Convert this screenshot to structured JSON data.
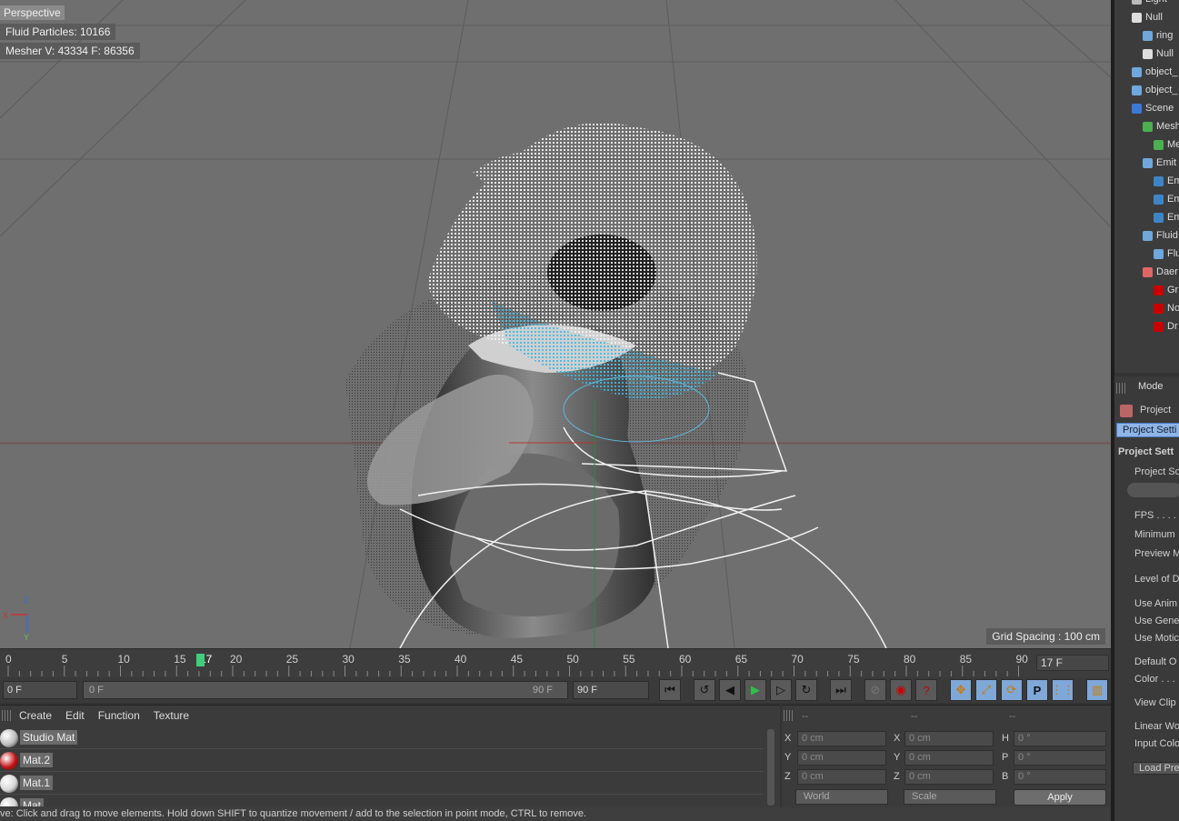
{
  "viewport": {
    "label": "Perspective",
    "hud_particles": "Fluid  Particles: 10166",
    "hud_mesher": "Mesher  V: 43334  F: 86356",
    "grid_spacing": "Grid Spacing : 100 cm"
  },
  "timeline": {
    "ticks": [
      "0",
      "5",
      "10",
      "15",
      "17",
      "20",
      "25",
      "30",
      "35",
      "40",
      "45",
      "50",
      "55",
      "60",
      "65",
      "70",
      "75",
      "80",
      "85",
      "90"
    ],
    "current_frame_box": "17 F",
    "start_field": "0 F",
    "range_start": "0 F",
    "range_end": "90 F",
    "end_field": "90 F"
  },
  "materials": {
    "menu": [
      "Create",
      "Edit",
      "Function",
      "Texture"
    ],
    "items": [
      {
        "name": "Studio Mat",
        "color": "#bdbdbd"
      },
      {
        "name": "Mat.2",
        "color": "#c41212"
      },
      {
        "name": "Mat.1",
        "color": "#d6d6d6"
      },
      {
        "name": "Mat",
        "color": "#cfcfcf"
      }
    ]
  },
  "coords": {
    "headers": [
      "--",
      "--",
      "--"
    ],
    "rows": [
      {
        "l1": "X",
        "v1": "0 cm",
        "l2": "X",
        "v2": "0 cm",
        "l3": "H",
        "v3": "0 °"
      },
      {
        "l1": "Y",
        "v1": "0 cm",
        "l2": "Y",
        "v2": "0 cm",
        "l3": "P",
        "v3": "0 °"
      },
      {
        "l1": "Z",
        "v1": "0 cm",
        "l2": "Z",
        "v2": "0 cm",
        "l3": "B",
        "v3": "0 °"
      }
    ],
    "space": "World",
    "mode": "Scale",
    "apply": "Apply"
  },
  "status": "ve: Click and drag to move elements. Hold down SHIFT to quantize movement / add to the selection in point mode, CTRL to remove.",
  "objects": [
    {
      "label": "Light",
      "indent": 18,
      "color": "#bbbbbb"
    },
    {
      "label": "Null",
      "indent": 18,
      "color": "#dddddd"
    },
    {
      "label": "ring",
      "indent": 30,
      "color": "#6fa8dc"
    },
    {
      "label": "Null",
      "indent": 30,
      "color": "#dddddd"
    },
    {
      "label": "object_",
      "indent": 18,
      "color": "#6fa8dc"
    },
    {
      "label": "object_",
      "indent": 18,
      "color": "#6fa8dc"
    },
    {
      "label": "Scene",
      "indent": 18,
      "color": "#3c78d8"
    },
    {
      "label": "Mesh",
      "indent": 30,
      "color": "#4caf50"
    },
    {
      "label": "Me",
      "indent": 42,
      "color": "#4caf50"
    },
    {
      "label": "Emit",
      "indent": 30,
      "color": "#6fa8dc"
    },
    {
      "label": "Em",
      "indent": 42,
      "color": "#3d85c6"
    },
    {
      "label": "Em",
      "indent": 42,
      "color": "#3d85c6"
    },
    {
      "label": "Em",
      "indent": 42,
      "color": "#3d85c6"
    },
    {
      "label": "Fluid",
      "indent": 30,
      "color": "#6fa8dc"
    },
    {
      "label": "Flu",
      "indent": 42,
      "color": "#6fa8dc"
    },
    {
      "label": "Daer",
      "indent": 30,
      "color": "#e06666"
    },
    {
      "label": "Gr",
      "indent": 42,
      "color": "#cc0000"
    },
    {
      "label": "No",
      "indent": 42,
      "color": "#cc0000"
    },
    {
      "label": "Dr",
      "indent": 42,
      "color": "#cc0000"
    }
  ],
  "attributes": {
    "mode": "Mode",
    "project": "Project",
    "tab": "Project Setti",
    "section": "Project Sett",
    "items": [
      "Project Sc",
      "FPS . . . . .",
      "Minimum",
      "Preview M",
      "Level of D",
      "Use Anim",
      "Use Gene",
      "Use Motic",
      "Default O",
      "Color . . .",
      "View Clip",
      "Linear Wo",
      "Input Colo",
      "Load Pre"
    ]
  }
}
